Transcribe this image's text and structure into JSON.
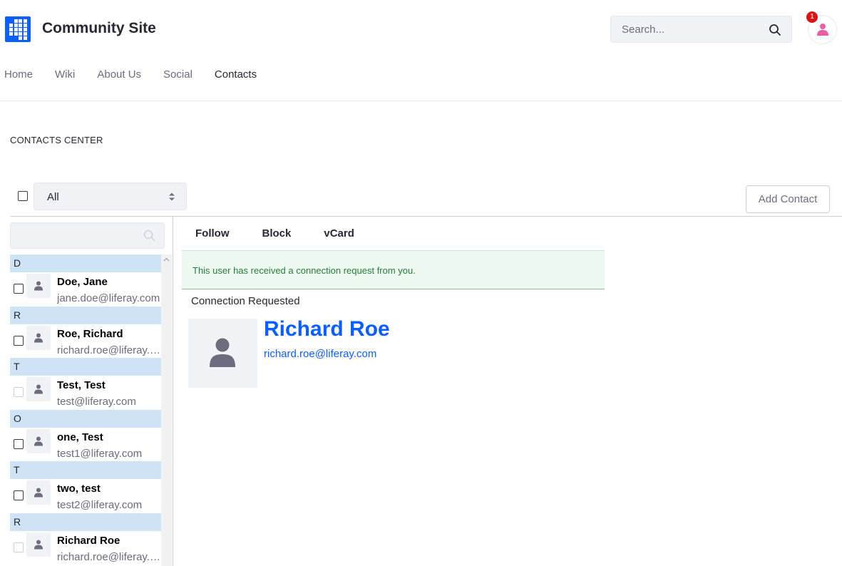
{
  "site": {
    "title": "Community Site"
  },
  "search": {
    "placeholder": "Search..."
  },
  "user_menu": {
    "notification_count": "1"
  },
  "nav": {
    "items": [
      {
        "label": "Home"
      },
      {
        "label": "Wiki"
      },
      {
        "label": "About Us"
      },
      {
        "label": "Social"
      },
      {
        "label": "Contacts",
        "active": true
      }
    ]
  },
  "portlet": {
    "title": "CONTACTS CENTER"
  },
  "toolbar": {
    "filter_selected": "All",
    "add_contact_label": "Add Contact"
  },
  "contacts_list": {
    "groups": [
      {
        "letter": "D",
        "contact": {
          "name": "Doe, Jane",
          "email": "jane.doe@liferay.com",
          "checkbox_enabled": true
        }
      },
      {
        "letter": "R",
        "contact": {
          "name": "Roe, Richard",
          "email": "richard.roe@liferay.com",
          "checkbox_enabled": true
        }
      },
      {
        "letter": "T",
        "contact": {
          "name": "Test, Test",
          "email": "test@liferay.com",
          "checkbox_enabled": false
        }
      },
      {
        "letter": "O",
        "contact": {
          "name": "one, Test",
          "email": "test1@liferay.com",
          "checkbox_enabled": true
        }
      },
      {
        "letter": "T",
        "contact": {
          "name": "two, test",
          "email": "test2@liferay.com",
          "checkbox_enabled": true
        }
      },
      {
        "letter": "R",
        "contact": {
          "name": "Richard Roe",
          "email": "richard.roe@liferay.com",
          "checkbox_enabled": false
        }
      }
    ]
  },
  "detail": {
    "actions": {
      "follow": "Follow",
      "block": "Block",
      "vcard": "vCard"
    },
    "alert_message": "This user has received a connection request from you.",
    "connection_status": "Connection Requested",
    "profile": {
      "name": "Richard Roe",
      "email": "richard.roe@liferay.com"
    }
  },
  "colors": {
    "accent": "#0b5fff",
    "group_header": "#cfe3f6",
    "alert_bg": "#edf9f0",
    "alert_text": "#287d3c",
    "badge": "#da1414",
    "avatar_icon": "#ea5ea3"
  },
  "icons": {
    "logo": "site-logo-grid",
    "search": "search-icon",
    "user": "user-icon",
    "select": "caret-double-icon"
  }
}
